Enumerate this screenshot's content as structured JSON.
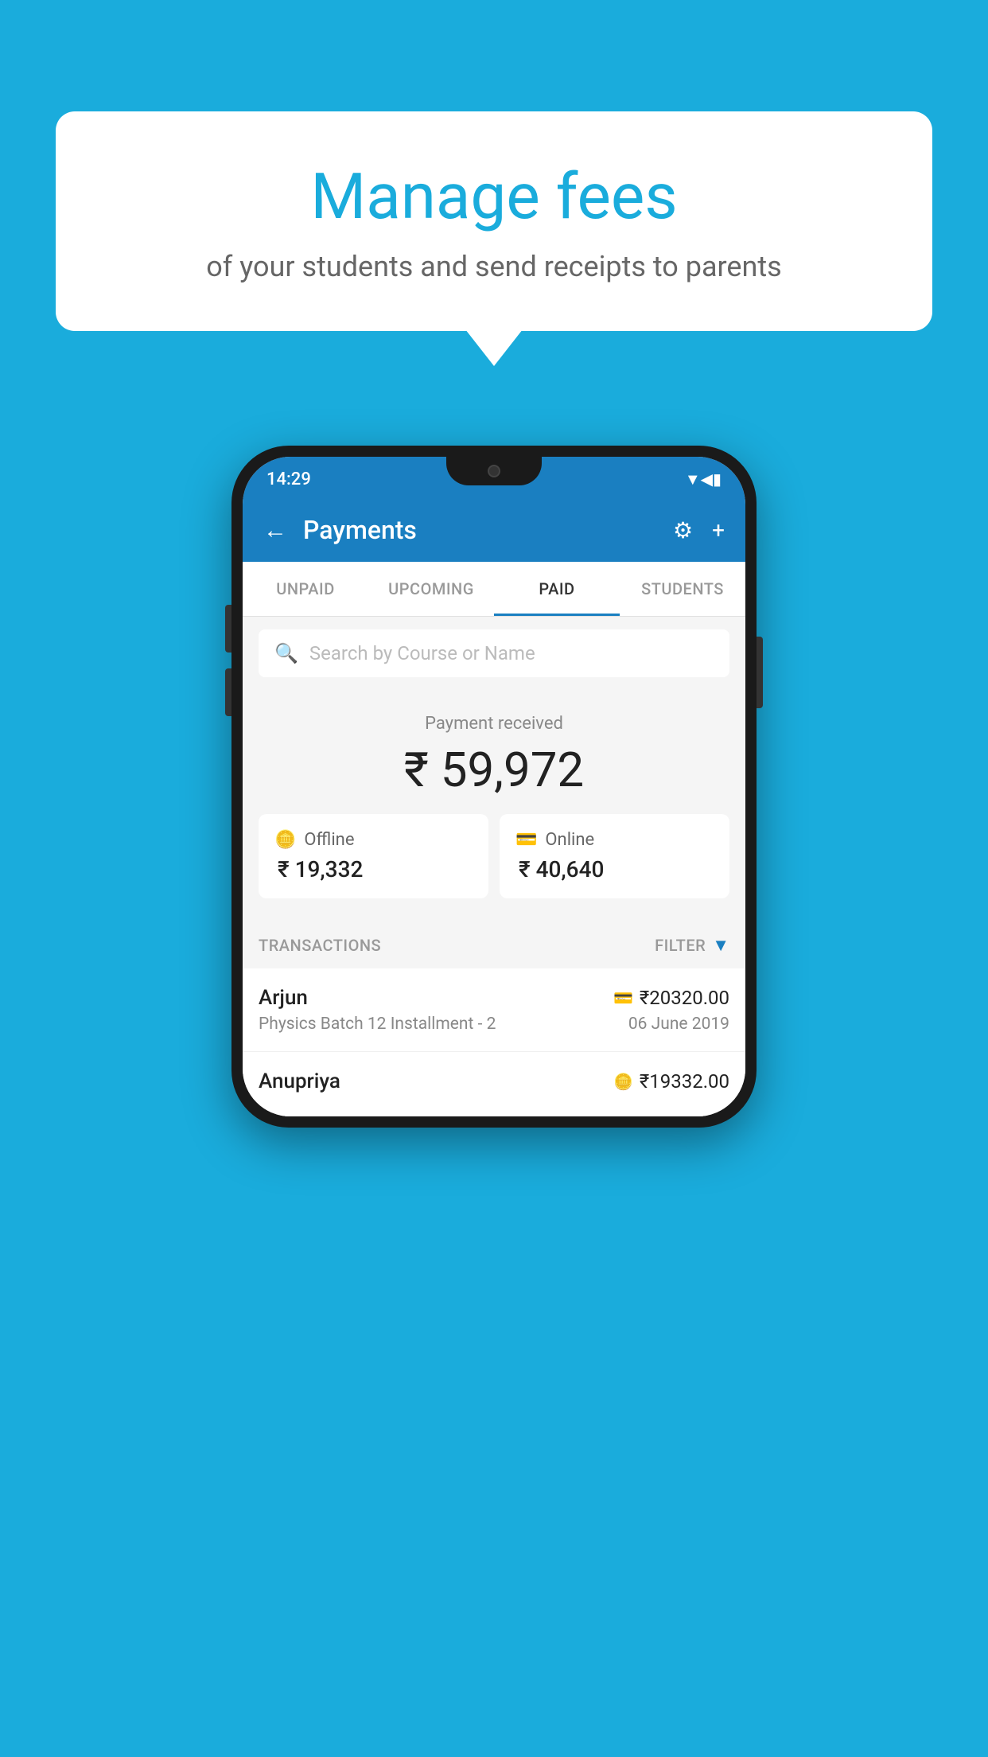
{
  "bubble": {
    "title": "Manage fees",
    "subtitle": "of your students and send receipts to parents"
  },
  "statusBar": {
    "time": "14:29",
    "icons": [
      "wifi",
      "signal",
      "battery"
    ]
  },
  "header": {
    "title": "Payments",
    "backLabel": "←",
    "settingsIcon": "⚙",
    "addIcon": "+"
  },
  "tabs": [
    {
      "label": "UNPAID",
      "active": false
    },
    {
      "label": "UPCOMING",
      "active": false
    },
    {
      "label": "PAID",
      "active": true
    },
    {
      "label": "STUDENTS",
      "active": false
    }
  ],
  "search": {
    "placeholder": "Search by Course or Name"
  },
  "payment": {
    "label": "Payment received",
    "amount": "₹ 59,972",
    "offline": {
      "label": "Offline",
      "amount": "₹ 19,332"
    },
    "online": {
      "label": "Online",
      "amount": "₹ 40,640"
    }
  },
  "transactions": {
    "header": "TRANSACTIONS",
    "filter": "FILTER",
    "rows": [
      {
        "name": "Arjun",
        "amount": "₹20320.00",
        "course": "Physics Batch 12 Installment - 2",
        "date": "06 June 2019",
        "type": "online"
      },
      {
        "name": "Anupriya",
        "amount": "₹19332.00",
        "course": "",
        "date": "",
        "type": "offline"
      }
    ]
  }
}
